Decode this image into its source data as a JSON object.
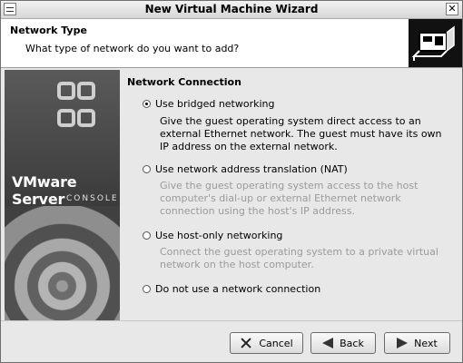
{
  "window": {
    "title": "New Virtual Machine Wizard",
    "close_glyph": "✕"
  },
  "header": {
    "title": "Network Type",
    "subtitle": "What type of network do you want to add?",
    "icon": "network-card-icon"
  },
  "brand": {
    "name": "VMware Server",
    "sub": "CONSOLE",
    "icon": "vmware-logo-icon"
  },
  "content": {
    "section_title": "Network Connection",
    "options": [
      {
        "label": "Use bridged networking",
        "checked": true,
        "description": "Give the guest operating system direct access to an external Ethernet network. The guest must have its own IP address on the external network.",
        "description_dim": false
      },
      {
        "label": "Use network address translation (NAT)",
        "checked": false,
        "description": "Give the guest operating system access to the host computer's dial-up or external Ethernet network connection using the host's IP address.",
        "description_dim": true
      },
      {
        "label": "Use host-only networking",
        "checked": false,
        "description": "Connect the guest operating system to a private virtual network on the host computer.",
        "description_dim": true
      },
      {
        "label": "Do not use a network connection",
        "checked": false,
        "description": "",
        "description_dim": true
      }
    ]
  },
  "buttons": {
    "cancel": "Cancel",
    "back": "Back",
    "next": "Next"
  },
  "colors": {
    "background": "#e8e8e8",
    "dim_text": "#9a9a9a",
    "header_bg": "#ffffff"
  }
}
